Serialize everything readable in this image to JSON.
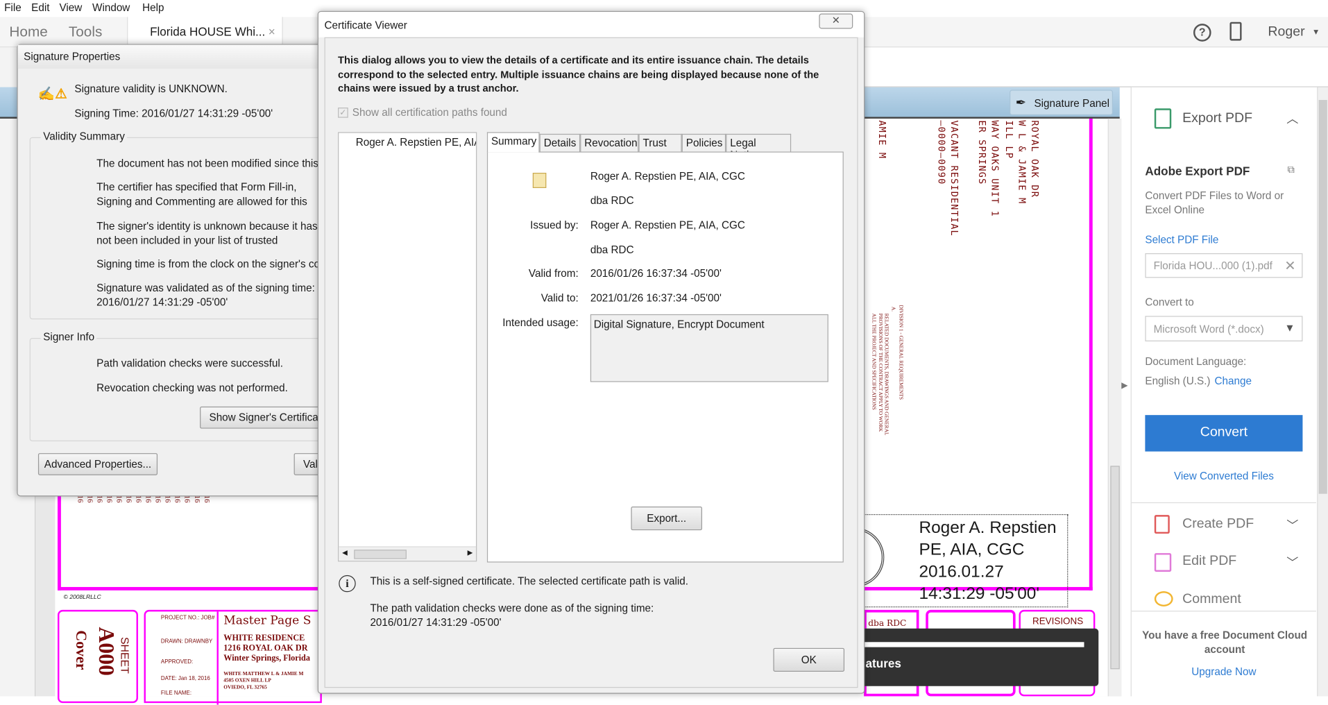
{
  "menu": [
    "File",
    "Edit",
    "View",
    "Window",
    "Help"
  ],
  "nav": {
    "home": "Home",
    "tools": "Tools",
    "doc_tab": "Florida HOUSE Whi...",
    "close": "×",
    "user": "Roger",
    "user_caret": "▾",
    "help": "?"
  },
  "signature_bar": {
    "button": "Signature Panel"
  },
  "document": {
    "vertical_texts": [
      "AMIE M",
      "—0000—0090",
      "VACANT RESIDENTIAL",
      "ER SPRINGS",
      "WAY OAKS UNIT 1",
      "ILL LP",
      "W L & JAMIE M",
      "ROYAL OAK DR"
    ],
    "spec_texts": [
      "DIVISION 1 - GENERAL REQUIREMENTS",
      "A.",
      "RELATED DOCUMENTS, DRAWINGS AND GENERAL",
      "PROVISIONS OF THE CONTRACT APPLY TO WORK",
      "ALL THE PROJECT AND SPECIFICATIONS"
    ],
    "dates_repeat": "016",
    "copyright": "© 2008LRLLC",
    "sheet_label": "SHEET",
    "sheet_no": "A000",
    "sheet_name": "Cover",
    "project_no": "PROJECT NO.: JOB#",
    "drawn": "DRAWN: DRAWNBY",
    "approved": "APPROVED:",
    "date": "DATE: Jan 18, 2016",
    "file": "FILE NAME:",
    "master": "Master Page S",
    "residence": [
      "WHITE RESIDENCE",
      "1216 ROYAL OAK DR",
      "Winter Springs, Florida"
    ],
    "owner": [
      "WHITE MATTHEW L & JAMIE M",
      "4505 OXEN HILL LP",
      "OVIEDO, FL 32765"
    ],
    "signature": [
      "Roger A. Repstien",
      "PE, AIA, CGC",
      "2016.01.27",
      "14:31:29 -05'00'"
    ],
    "dba": "dba RDC",
    "revisions": "REVISIONS"
  },
  "toast": {
    "text": "atures",
    "progress": 1.0
  },
  "right_pane": {
    "export_header": "Export PDF",
    "adobe_export": "Adobe Export PDF",
    "desc": "Convert PDF Files to Word or Excel Online",
    "select_file": "Select PDF File",
    "file_value": "Florida HOU...000 (1).pdf",
    "convert_to": "Convert to",
    "format": "Microsoft Word (*.docx)",
    "doc_lang_label": "Document Language:",
    "doc_lang": "English (U.S.)",
    "change": "Change",
    "convert_btn": "Convert",
    "view_converted": "View Converted Files",
    "tools": [
      "Create PDF",
      "Edit PDF",
      "Comment"
    ],
    "cloud_msg": "You have a free Document Cloud account",
    "upgrade": "Upgrade Now",
    "accent": "#2d7bd2"
  },
  "sig_props": {
    "title": "Signature Properties",
    "validity": "Signature validity is UNKNOWN.",
    "signing_time": "Signing Time:  2016/01/27 14:31:29 -05'00'",
    "validity_summary": "Validity Summary",
    "summary_items": [
      "The document has not been modified since this signature was applied.",
      "The certifier has specified that Form Fill-in, Signing and Commenting are allowed for this document. No other changes are permitted.",
      "The signer's identity is unknown because it has not been included in your list of trusted certificates and none of its parent certificates are trusted certificates.",
      "Signing time is from the clock on the signer's computer.",
      "Signature was validated as of the signing time: 2016/01/27 14:31:29 -05'00'"
    ],
    "signer_info": "Signer Info",
    "signer_items": [
      "Path validation checks were successful.",
      "Revocation checking was not performed."
    ],
    "show_cert": "Show Signer's Certificate...",
    "advanced": "Advanced Properties...",
    "validate": "Validate Signature"
  },
  "cert_viewer": {
    "title": "Certificate Viewer",
    "intro": "This dialog allows you to view the details of a certificate and its entire issuance chain. The details correspond to the selected entry. Multiple issuance chains are being displayed because none of the chains were issued by a trust anchor.",
    "show_all": "Show all certification paths found",
    "show_all_checked": true,
    "tree_item": "Roger A. Repstien PE, AIA, CGC",
    "tabs": [
      "Summary",
      "Details",
      "Revocation",
      "Trust",
      "Policies",
      "Legal Notice"
    ],
    "active_tab": "Summary",
    "subject": [
      "Roger A. Repstien PE, AIA, CGC",
      "dba RDC"
    ],
    "issued_by_label": "Issued by:",
    "issued_by": [
      "Roger A. Repstien PE, AIA, CGC",
      "dba RDC"
    ],
    "valid_from_label": "Valid from:",
    "valid_from": "2016/01/26 16:37:34 -05'00'",
    "valid_to_label": "Valid to:",
    "valid_to": "2021/01/26 16:37:34 -05'00'",
    "usage_label": "Intended usage:",
    "usage": "Digital Signature, Encrypt Document",
    "export": "Export...",
    "info1": "This is a self-signed certificate. The selected certificate path is valid.",
    "info2": "The path validation checks were done as of the signing time:",
    "info3": "2016/01/27 14:31:29 -05'00'",
    "ok": "OK",
    "close": "✕"
  }
}
